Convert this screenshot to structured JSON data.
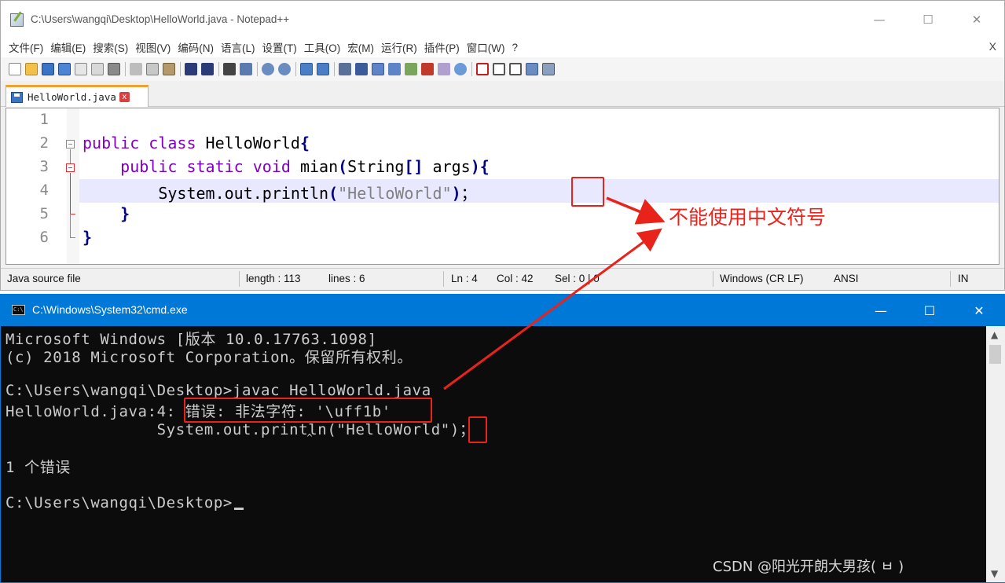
{
  "notepad": {
    "title": "C:\\Users\\wangqi\\Desktop\\HelloWorld.java - Notepad++",
    "controls": {
      "minimize": "—",
      "maximize": "☐",
      "close": "✕"
    },
    "menu": [
      "文件(F)",
      "编辑(E)",
      "搜索(S)",
      "视图(V)",
      "编码(N)",
      "语言(L)",
      "设置(T)",
      "工具(O)",
      "宏(M)",
      "运行(R)",
      "插件(P)",
      "窗口(W)",
      "?"
    ],
    "menu_close": "X",
    "tab": {
      "label": "HelloWorld.java",
      "close": "x"
    },
    "line_numbers": [
      "1",
      "2",
      "3",
      "4",
      "5",
      "6"
    ],
    "code": {
      "l2_kw": "public class ",
      "l2_name": "HelloWorld",
      "l2_brace": "{",
      "l3_indent": "    ",
      "l3_kw": "public static void ",
      "l3_name": "mian",
      "l3_paren_open": "(",
      "l3_type": "String",
      "l3_brackets": "[]",
      "l3_args": " args",
      "l3_paren_close": ")",
      "l3_brace": "{",
      "l4_indent": "        ",
      "l4_call": "System.out.println",
      "l4_paren_open": "(",
      "l4_string": "\"HelloWorld\"",
      "l4_paren_close": ")",
      "l4_semicolon": "；",
      "l5_indent": "    ",
      "l5_brace": "}",
      "l6_brace": "}"
    },
    "status": {
      "file_type": "Java source file",
      "length": "length : 113",
      "lines": "lines : 6",
      "ln": "Ln : 4",
      "col": "Col : 42",
      "sel": "Sel : 0 | 0",
      "eol": "Windows (CR LF)",
      "encoding": "ANSI",
      "mode": "IN"
    }
  },
  "cmd": {
    "title": "C:\\Windows\\System32\\cmd.exe",
    "icon_text": "C:\\",
    "controls": {
      "minimize": "—",
      "maximize": "☐",
      "close": "✕"
    },
    "lines": [
      "Microsoft Windows [版本 10.0.17763.1098]",
      "(c) 2018 Microsoft Corporation。保留所有权利。",
      "",
      "C:\\Users\\wangqi\\Desktop>javac HelloWorld.java",
      "HelloWorld.java:4: 错误: 非法字符: '\\uff1b'",
      "                System.out.println(\"HelloWorld\")；",
      "                                                 ^",
      "1 个错误",
      "",
      "C:\\Users\\wangqi\\Desktop>"
    ],
    "scroll": {
      "up": "▲",
      "down": "▼"
    }
  },
  "annotation": {
    "label": "不能使用中文符号",
    "color": "#e8231c"
  },
  "watermark": "CSDN @阳光开朗大男孩(  ㅂ  )",
  "colors": {
    "keyword": "#8000c0",
    "string": "#808080",
    "operator": "#000080",
    "current_line": "#e8e8ff",
    "cmd_background": "#0c0c0c",
    "cmd_text": "#cccccc",
    "cmd_titlebar": "#0078d7"
  }
}
